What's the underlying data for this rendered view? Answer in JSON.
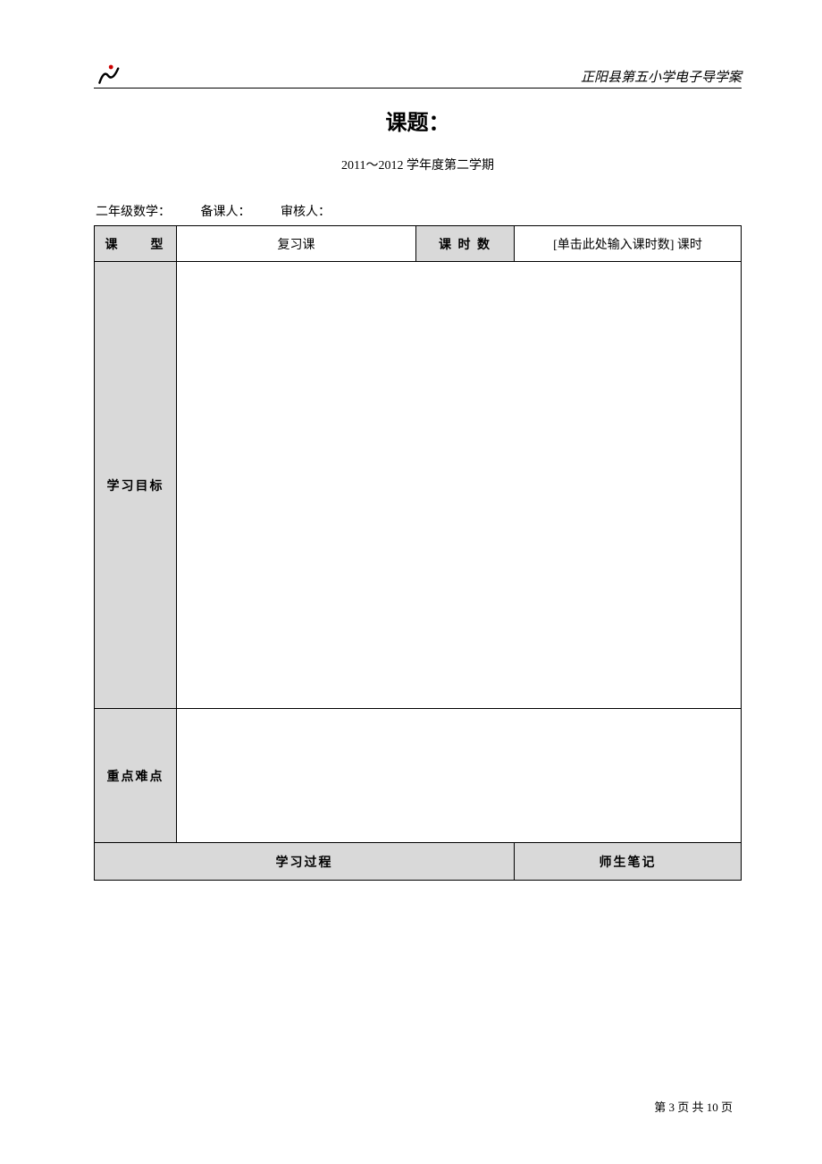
{
  "header": {
    "school_name": "正阳县第五小学电子导学案"
  },
  "title": "课题：",
  "subtitle": "2011～2012 学年度第二学期",
  "info": {
    "grade_subject": "二年级数学：",
    "preparer_label": "备课人：",
    "reviewer_label": "审核人："
  },
  "table": {
    "row_type": {
      "label": "课　　型",
      "value": "复习课",
      "hours_label": "课 时 数",
      "hours_value": "[单击此处输入课时数]  课时"
    },
    "row_goals_label": "学习目标",
    "row_focus_label": "重点难点",
    "row_process": {
      "process_label": "学习过程",
      "notes_label": "师生笔记"
    }
  },
  "footer": {
    "page_text": "第 3 页 共 10 页"
  }
}
